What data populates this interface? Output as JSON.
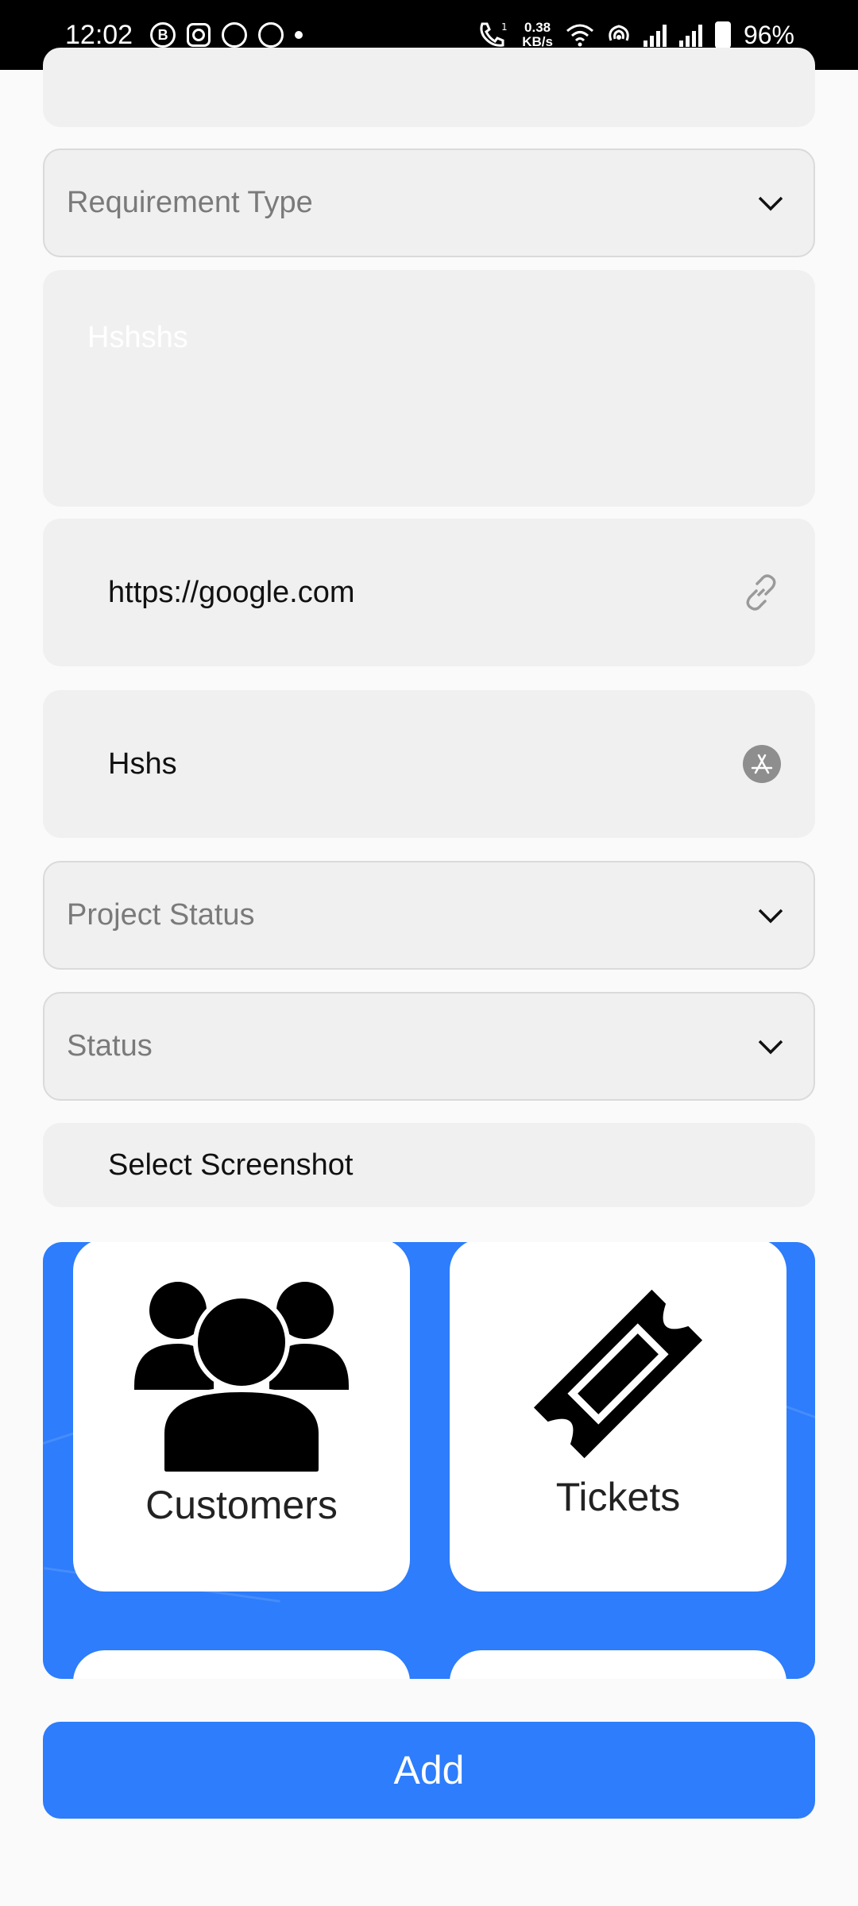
{
  "status_bar": {
    "time": "12:02",
    "net_speed_value": "0.38",
    "net_speed_unit": "KB/s",
    "battery": "96%",
    "notification_icons": [
      "b-circle-icon",
      "instagram-icon",
      "app-icon",
      "sync-icon",
      "dot-icon"
    ]
  },
  "form": {
    "requirement_type_label": "Requirement Type",
    "description_value": "Hshshs",
    "url_value": "https://google.com",
    "app_name_value": "Hshs",
    "project_status_label": "Project Status",
    "status_label": "Status",
    "select_screenshot_label": "Select Screenshot"
  },
  "cards": {
    "customers_label": "Customers",
    "tickets_label": "Tickets"
  },
  "add_button_label": "Add",
  "colors": {
    "accent": "#2d7dfc",
    "field_bg": "#f0f0f0",
    "placeholder": "#7a7a7a"
  }
}
